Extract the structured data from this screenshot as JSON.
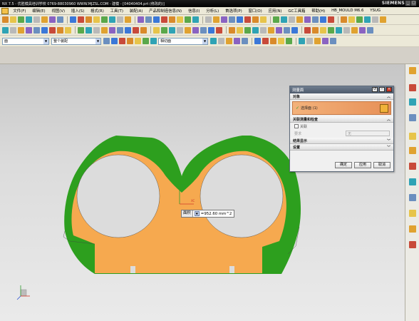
{
  "window": {
    "title": "NX 7.5 - 优胜模具培训学校 0769-88030960 WWW.MJZSL.COM - 建模 - [04040404.prt (修改的)]",
    "brand": "SIEMENS",
    "controls": [
      "_",
      "□",
      "×"
    ]
  },
  "menubar": {
    "items": [
      "文件(F)",
      "编辑(E)",
      "视图(V)",
      "插入(S)",
      "格式(R)",
      "工具(T)",
      "装配(A)",
      "产品和制造信息(N)",
      "信息(I)",
      "分析(L)",
      "首选项(P)",
      "窗口(O)",
      "应用(N)",
      "GC工具箱",
      "帮助(H)",
      "HB_MOULD M6.6",
      "YSUG"
    ]
  },
  "selection_bar": {
    "filter_value": "面",
    "scope_value": "整个装配",
    "snap_value": "相切面"
  },
  "dialog": {
    "title": "测量面",
    "section_object": "对象",
    "select_face_label": "选择面 (1)",
    "section_associated": "关联测量和检查",
    "associate_checkbox": "关联",
    "requirement_label": "要求",
    "requirement_value": "无",
    "section_results": "结果显示",
    "section_settings": "设置",
    "ok": "确定",
    "apply": "应用",
    "cancel": "取消"
  },
  "measurement": {
    "type_label": "面积",
    "value": "=952.60 mm^2"
  },
  "colors": {
    "part_green": "#2d9f1e",
    "part_orange": "#f6a94f",
    "dialog_header": "#5b687a",
    "selected_row": "#ee9f63"
  },
  "icons": {
    "axis_triad": "xyz-triad-icon",
    "select_face": "face-select-icon"
  }
}
